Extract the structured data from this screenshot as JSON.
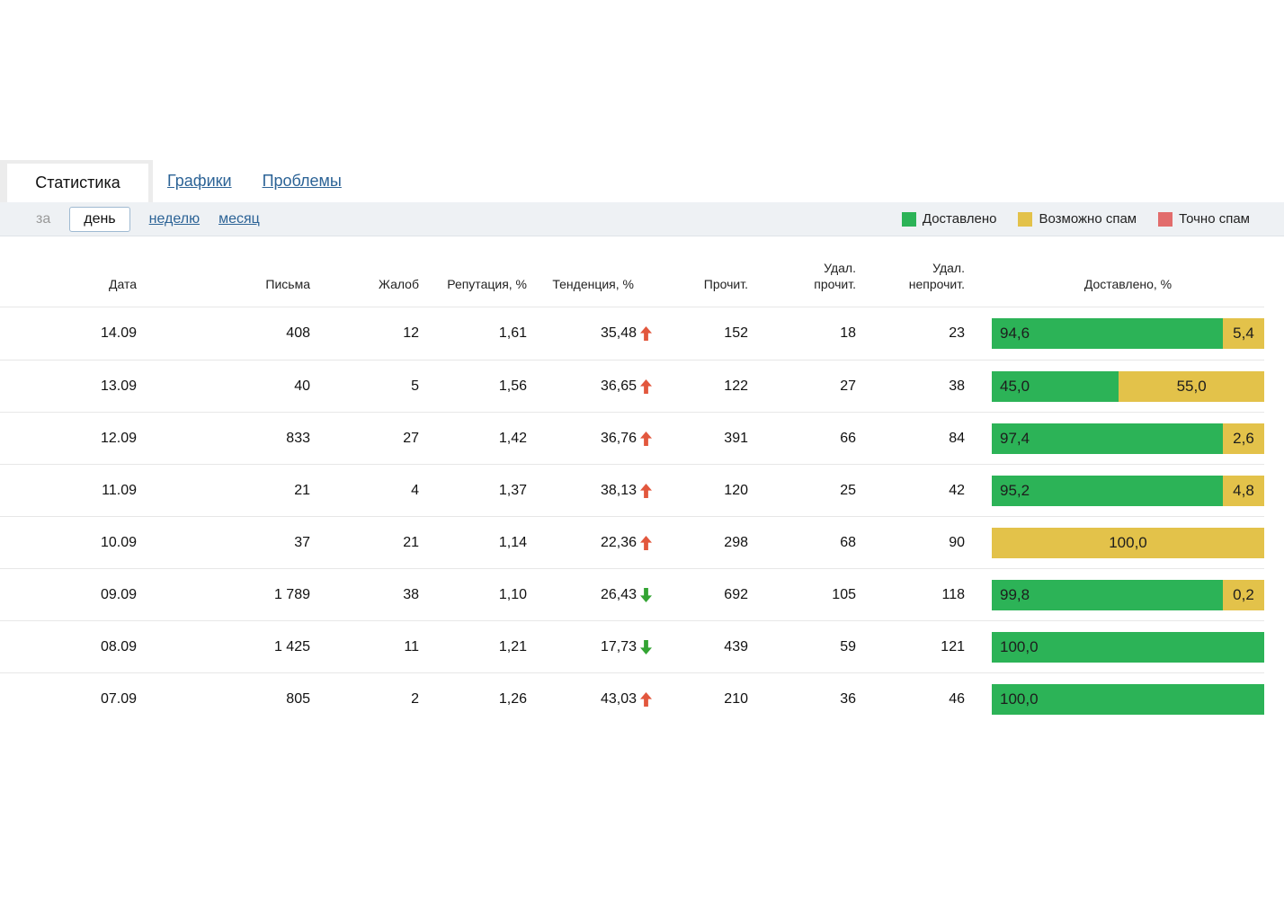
{
  "tabs": [
    {
      "id": "statistics",
      "label": "Статистика",
      "active": true
    },
    {
      "id": "charts",
      "label": "Графики",
      "active": false
    },
    {
      "id": "problems",
      "label": "Проблемы",
      "active": false
    }
  ],
  "period": {
    "prefix": "за",
    "options": [
      {
        "id": "day",
        "label": "день",
        "selected": true
      },
      {
        "id": "week",
        "label": "неделю",
        "selected": false
      },
      {
        "id": "month",
        "label": "месяц",
        "selected": false
      }
    ]
  },
  "legend": [
    {
      "id": "delivered",
      "label": "Доставлено",
      "color": "#2cb357"
    },
    {
      "id": "maybe_spam",
      "label": "Возможно спам",
      "color": "#e3c24a"
    },
    {
      "id": "sure_spam",
      "label": "Точно спам",
      "color": "#e26c6c"
    }
  ],
  "colors": {
    "delivered": "#2cb357",
    "maybe_spam": "#e3c24a",
    "sure_spam": "#e26c6c",
    "trend_up": "#e2573d",
    "trend_down": "#33a433"
  },
  "table": {
    "columns": [
      {
        "key": "date",
        "label": "Дата"
      },
      {
        "key": "letters",
        "label": "Письма"
      },
      {
        "key": "complaints",
        "label": "Жалоб"
      },
      {
        "key": "reputation",
        "label": "Репутация, %"
      },
      {
        "key": "trend",
        "label": "Тенденция, %"
      },
      {
        "key": "read",
        "label": "Прочит."
      },
      {
        "key": "deleted-read",
        "label": "Удал.\nпрочит."
      },
      {
        "key": "deleted-unread",
        "label": "Удал.\nнепрочит."
      },
      {
        "key": "delivered",
        "label": "Доставлено, %"
      }
    ],
    "rows": [
      {
        "date": "14.09",
        "letters": "408",
        "complaints": "12",
        "reputation": "1,61",
        "trend": "35,48",
        "trend_dir": "up",
        "read": "152",
        "del_read": "18",
        "del_unread": "23",
        "delivered": [
          {
            "type": "delivered",
            "label": "94,6",
            "pct": 94.6
          },
          {
            "type": "maybe_spam",
            "label": "5,4",
            "pct": 5.4
          }
        ]
      },
      {
        "date": "13.09",
        "letters": "40",
        "complaints": "5",
        "reputation": "1,56",
        "trend": "36,65",
        "trend_dir": "up",
        "read": "122",
        "del_read": "27",
        "del_unread": "38",
        "delivered": [
          {
            "type": "delivered",
            "label": "45,0",
            "pct": 45.0
          },
          {
            "type": "maybe_spam",
            "label": "55,0",
            "pct": 55.0
          }
        ]
      },
      {
        "date": "12.09",
        "letters": "833",
        "complaints": "27",
        "reputation": "1,42",
        "trend": "36,76",
        "trend_dir": "up",
        "read": "391",
        "del_read": "66",
        "del_unread": "84",
        "delivered": [
          {
            "type": "delivered",
            "label": "97,4",
            "pct": 97.4
          },
          {
            "type": "maybe_spam",
            "label": "2,6",
            "pct": 2.6
          }
        ]
      },
      {
        "date": "11.09",
        "letters": "21",
        "complaints": "4",
        "reputation": "1,37",
        "trend": "38,13",
        "trend_dir": "up",
        "read": "120",
        "del_read": "25",
        "del_unread": "42",
        "delivered": [
          {
            "type": "delivered",
            "label": "95,2",
            "pct": 95.2
          },
          {
            "type": "maybe_spam",
            "label": "4,8",
            "pct": 4.8
          }
        ]
      },
      {
        "date": "10.09",
        "letters": "37",
        "complaints": "21",
        "reputation": "1,14",
        "trend": "22,36",
        "trend_dir": "up",
        "read": "298",
        "del_read": "68",
        "del_unread": "90",
        "delivered": [
          {
            "type": "maybe_spam",
            "label": "100,0",
            "pct": 100.0
          }
        ]
      },
      {
        "date": "09.09",
        "letters": "1 789",
        "complaints": "38",
        "reputation": "1,10",
        "trend": "26,43",
        "trend_dir": "down",
        "read": "692",
        "del_read": "105",
        "del_unread": "118",
        "delivered": [
          {
            "type": "delivered",
            "label": "99,8",
            "pct": 99.8
          },
          {
            "type": "maybe_spam",
            "label": "0,2",
            "pct": 0.2
          }
        ]
      },
      {
        "date": "08.09",
        "letters": "1 425",
        "complaints": "11",
        "reputation": "1,21",
        "trend": "17,73",
        "trend_dir": "down",
        "read": "439",
        "del_read": "59",
        "del_unread": "121",
        "delivered": [
          {
            "type": "delivered",
            "label": "100,0",
            "pct": 100.0
          }
        ]
      },
      {
        "date": "07.09",
        "letters": "805",
        "complaints": "2",
        "reputation": "1,26",
        "trend": "43,03",
        "trend_dir": "up",
        "read": "210",
        "del_read": "36",
        "del_unread": "46",
        "delivered": [
          {
            "type": "delivered",
            "label": "100,0",
            "pct": 100.0
          }
        ]
      }
    ]
  }
}
